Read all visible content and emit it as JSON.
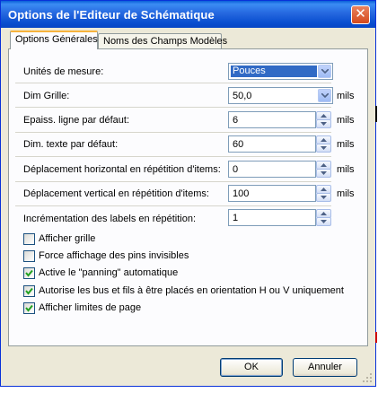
{
  "window": {
    "title": "Options de l'Editeur de Schématique"
  },
  "tabs": [
    {
      "label": "Options Générales",
      "active": true
    },
    {
      "label": "Noms des Champs Modèles",
      "active": false
    }
  ],
  "fields": {
    "units": {
      "label": "Unités de mesure:",
      "value": "Pouces"
    },
    "grid": {
      "label": "Dim Grille:",
      "value": "50,0",
      "unit": "mils"
    },
    "line": {
      "label": "Epaiss. ligne par défaut:",
      "value": "6",
      "unit": "mils"
    },
    "text": {
      "label": "Dim. texte par défaut:",
      "value": "60",
      "unit": "mils"
    },
    "hmove": {
      "label": "Déplacement horizontal en répétition d'items:",
      "value": "0",
      "unit": "mils"
    },
    "vmove": {
      "label": "Déplacement vertical en répétition d'items:",
      "value": "100",
      "unit": "mils"
    },
    "labelinc": {
      "label": "Incrémentation des labels en répétition:",
      "value": "1"
    }
  },
  "checkboxes": [
    {
      "label": "Afficher grille",
      "checked": false
    },
    {
      "label": "Force affichage des pins invisibles",
      "checked": false
    },
    {
      "label": "Active le \"panning\" automatique",
      "checked": true
    },
    {
      "label": "Autorise les bus et fils à être placés en orientation H ou V uniquement",
      "checked": true
    },
    {
      "label": "Afficher limites de page",
      "checked": true
    }
  ],
  "buttons": {
    "ok": "OK",
    "cancel": "Annuler"
  },
  "colors": {
    "title_bar": "#0a4fd0",
    "dialog_bg": "#ece9d8",
    "panel_bg": "#fcfcfe",
    "selection": "#316ac5",
    "close": "#d5491c"
  }
}
